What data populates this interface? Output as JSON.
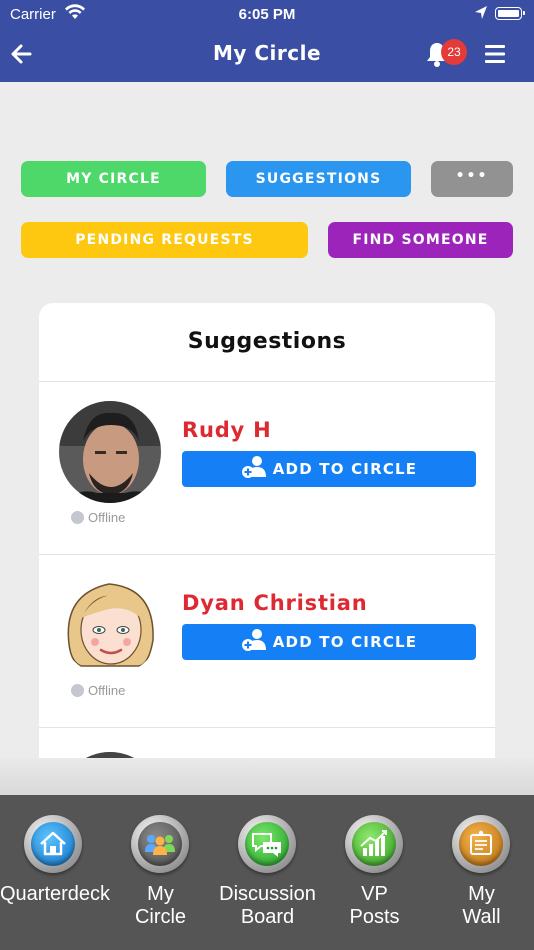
{
  "status_bar": {
    "carrier": "Carrier",
    "time": "6:05 PM"
  },
  "header": {
    "title": "My Circle",
    "notification_count": "23"
  },
  "filters": {
    "my_circle": "MY CIRCLE",
    "suggestions": "SUGGESTIONS",
    "more": "•••",
    "pending_requests": "PENDING REQUESTS",
    "find_someone": "FIND SOMEONE"
  },
  "card": {
    "title": "Suggestions",
    "people": [
      {
        "name": "Rudy H",
        "status": "Offline",
        "button": "ADD TO CIRCLE"
      },
      {
        "name": "Dyan Christian",
        "status": "Offline",
        "button": "ADD TO CIRCLE"
      }
    ]
  },
  "tabs": [
    {
      "label": "Quarterdeck",
      "icon": "home-icon"
    },
    {
      "label": "My\nCircle",
      "icon": "people-icon"
    },
    {
      "label": "Discussion\nBoard",
      "icon": "chat-icon"
    },
    {
      "label": "VP\nPosts",
      "icon": "chart-icon"
    },
    {
      "label": "My\nWall",
      "icon": "noteboard-icon"
    }
  ],
  "colors": {
    "header": "#3a4fa3",
    "my_circle": "#4ed86a",
    "suggestions": "#2b96ef",
    "more": "#929292",
    "pending": "#fdc80f",
    "find": "#9d24ba",
    "name": "#dd2a32",
    "add_button": "#1580f5",
    "tab_bar": "#555555"
  }
}
